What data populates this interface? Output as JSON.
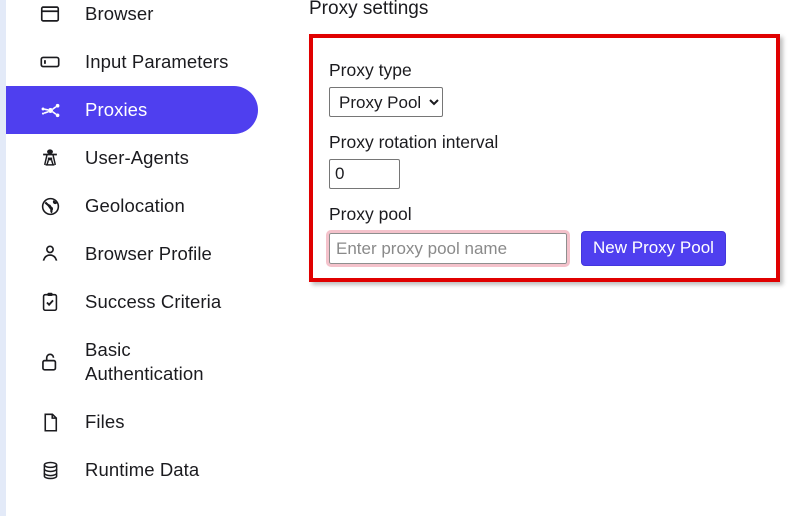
{
  "sidebar": {
    "items": [
      {
        "label": "Browser",
        "icon": "browser-window-icon",
        "active": false,
        "two_line": false
      },
      {
        "label": "Input Parameters",
        "icon": "input-field-icon",
        "active": false,
        "two_line": false
      },
      {
        "label": "Proxies",
        "icon": "proxy-network-icon",
        "active": true,
        "two_line": false
      },
      {
        "label": "User-Agents",
        "icon": "detective-icon",
        "active": false,
        "two_line": false
      },
      {
        "label": "Geolocation",
        "icon": "globe-icon",
        "active": false,
        "two_line": false
      },
      {
        "label": "Browser Profile",
        "icon": "person-icon",
        "active": false,
        "two_line": false
      },
      {
        "label": "Success Criteria",
        "icon": "clipboard-check-icon",
        "active": false,
        "two_line": false
      },
      {
        "label": "Basic\nAuthentication",
        "icon": "unlocked-padlock-icon",
        "active": false,
        "two_line": true
      },
      {
        "label": "Files",
        "icon": "file-document-icon",
        "active": false,
        "two_line": false
      },
      {
        "label": "Runtime Data",
        "icon": "database-icon",
        "active": false,
        "two_line": false
      }
    ]
  },
  "main": {
    "page_title": "Proxy settings",
    "proxy_type": {
      "label": "Proxy type",
      "selected": "Proxy Pool",
      "options": [
        "Proxy Pool"
      ]
    },
    "rotation_interval": {
      "label": "Proxy rotation interval",
      "value": "0"
    },
    "proxy_pool": {
      "label": "Proxy pool",
      "placeholder": "Enter proxy pool name",
      "value": "",
      "button_label": "New Proxy Pool"
    }
  },
  "colors": {
    "accent": "#4f3fef",
    "highlight_border": "#e00000",
    "input_focus_ring": "#f4c2cb",
    "edge_strip": "#e3eaf8"
  }
}
